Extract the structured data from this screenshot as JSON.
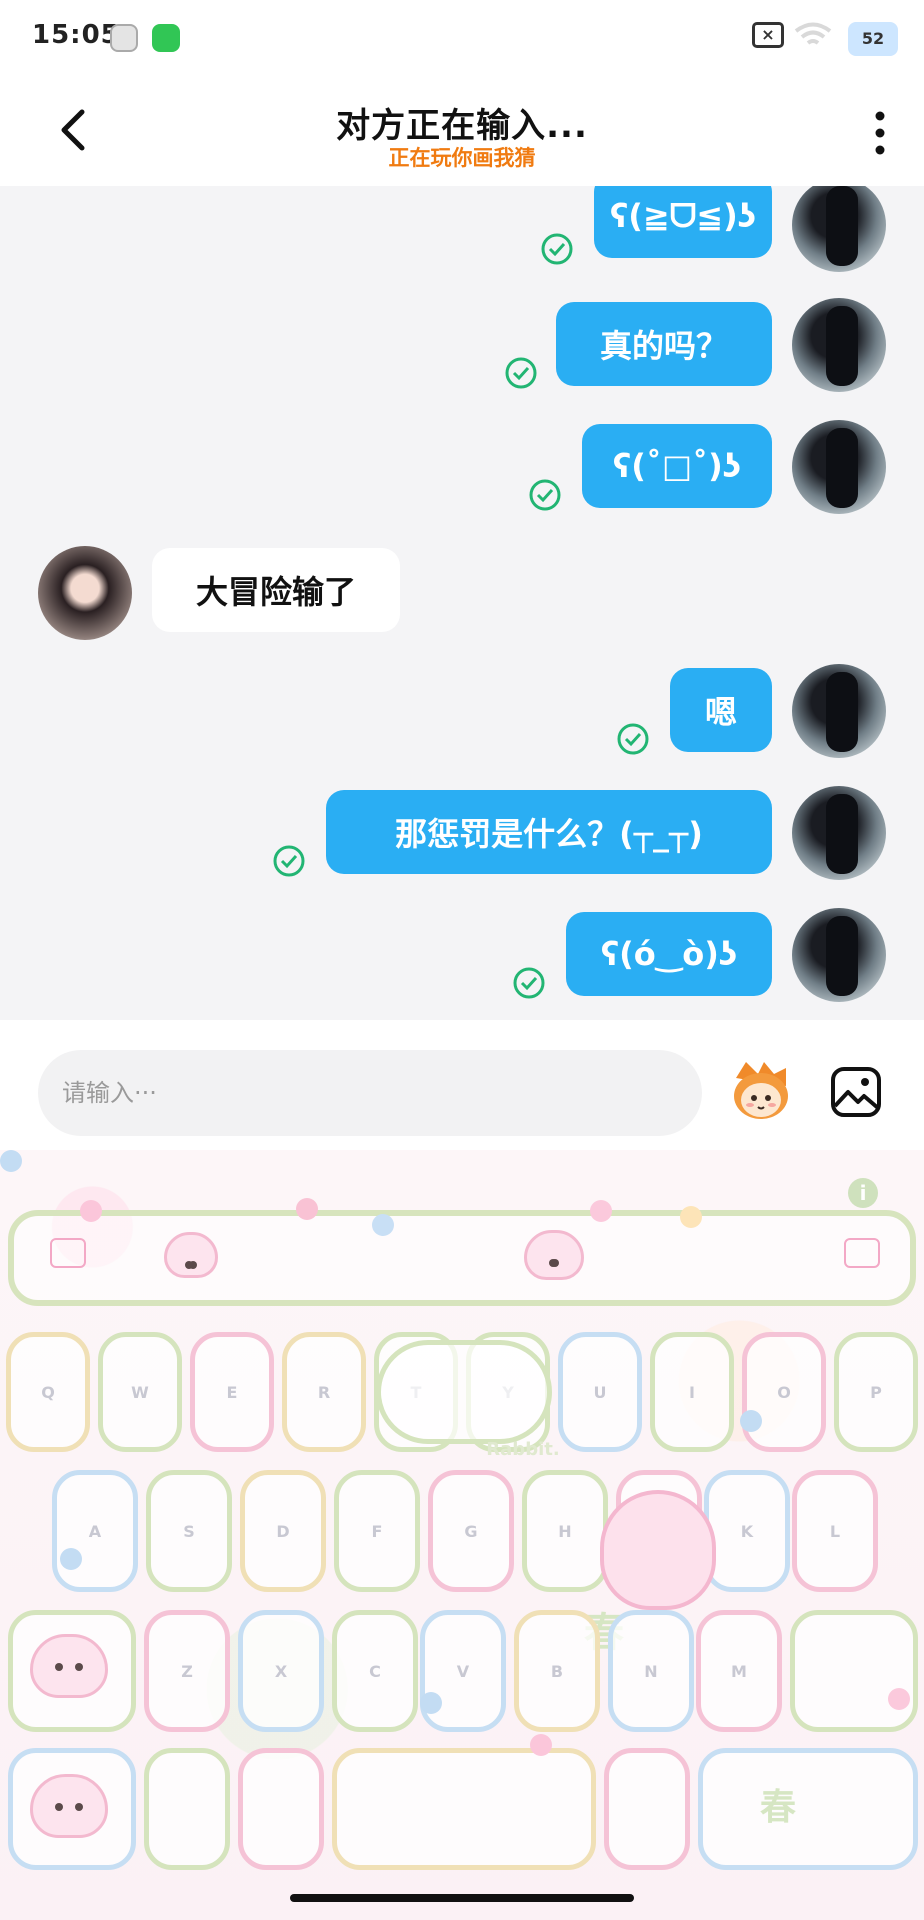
{
  "status_bar": {
    "time": "15:05",
    "battery": "52"
  },
  "header": {
    "title": "对方正在输入...",
    "subtitle": "正在玩你画我猜"
  },
  "messages": [
    {
      "side": "me",
      "text": "ʕ(≧ᗜ≦)ʖ",
      "read": true
    },
    {
      "side": "me",
      "text": "真的吗？",
      "read": true
    },
    {
      "side": "me",
      "text": "ʕ(˚□˚)ʖ",
      "read": true
    },
    {
      "side": "other",
      "text": "大冒险输了"
    },
    {
      "side": "me",
      "text": "嗯",
      "read": true
    },
    {
      "side": "me",
      "text": "那惩罚是什么？(┬_┬)",
      "read": true
    },
    {
      "side": "me",
      "text": "ʕ(ό‿ὸ)ʖ",
      "read": true
    }
  ],
  "composer": {
    "placeholder": "请输入···"
  },
  "keyboard": {
    "row1": [
      "Q",
      "W",
      "E",
      "R",
      "T",
      "Y",
      "U",
      "I",
      "O",
      "P"
    ],
    "row2": [
      "A",
      "S",
      "D",
      "F",
      "G",
      "H",
      "J",
      "K",
      "L"
    ],
    "row3": [
      "Z",
      "X",
      "C",
      "V",
      "B",
      "N",
      "M"
    ],
    "theme_text": "春",
    "badge_text": "Rabbit."
  },
  "colors": {
    "bubble_me": "#2aaef3",
    "read_tick": "#22b573",
    "subtitle": "#f07b11"
  }
}
